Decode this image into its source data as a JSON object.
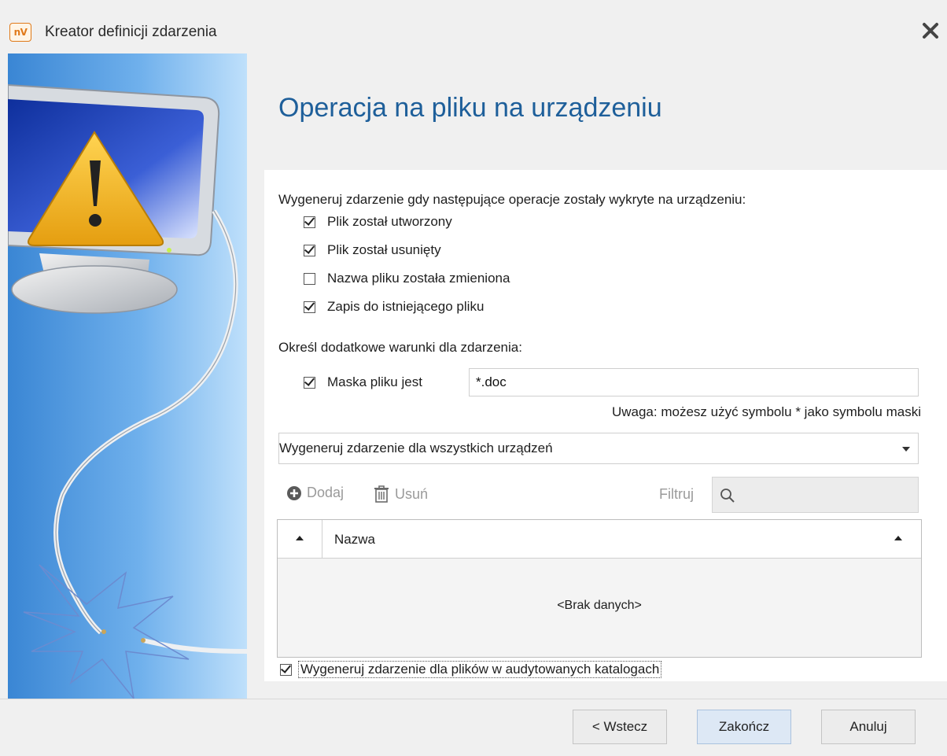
{
  "window": {
    "app_icon": "nV",
    "title": "Kreator definicji zdarzenia",
    "close_icon": "close-icon"
  },
  "page": {
    "title": "Operacja na pliku na urządzeniu",
    "intro": "Wygeneruj zdarzenie gdy następujące operacje zostały wykryte na urządzeniu:",
    "operations": [
      {
        "label": "Plik został utworzony",
        "checked": true
      },
      {
        "label": "Plik został usunięty",
        "checked": true
      },
      {
        "label": "Nazwa pliku została zmieniona",
        "checked": false
      },
      {
        "label": "Zapis do  istniejącego pliku",
        "checked": true
      }
    ],
    "conditions_label": "Określ dodatkowe warunki dla zdarzenia:",
    "mask": {
      "label": "Maska pliku jest",
      "checked": true,
      "value": "*.doc"
    },
    "mask_hint": "Uwaga: możesz użyć symbolu * jako symbolu maski",
    "device_select": {
      "value": "Wygeneruj zdarzenie dla wszystkich urządzeń"
    },
    "toolbar": {
      "add_label": "Dodaj",
      "remove_label": "Usuń",
      "filter_label": "Filtruj"
    },
    "grid": {
      "column": "Nazwa",
      "empty": "<Brak danych>"
    },
    "audited": {
      "label": "Wygeneruj zdarzenie dla plików w audytowanych katalogach",
      "checked": true
    }
  },
  "footer": {
    "back": "< Wstecz",
    "finish": "Zakończ",
    "cancel": "Anuluj"
  },
  "colors": {
    "title_blue": "#1e5f9a",
    "panel_blue": "#4f95dc",
    "warning_yellow": "#f2b41e"
  }
}
